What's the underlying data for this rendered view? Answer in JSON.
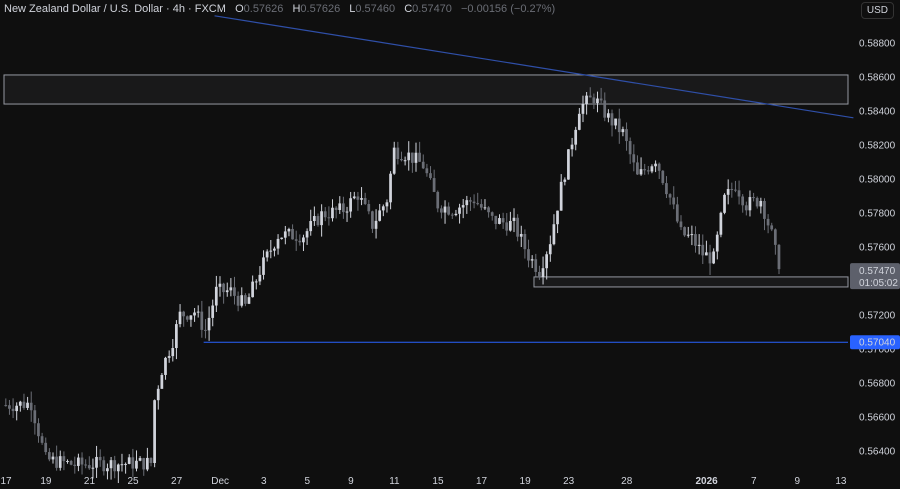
{
  "legend": {
    "title": "New Zealand Dollar / U.S. Dollar · 4h · FXCM",
    "o_label": "O",
    "o": "0.57626",
    "h_label": "H",
    "h": "0.57626",
    "l_label": "L",
    "l": "0.57460",
    "c_label": "C",
    "c": "0.57470",
    "change": "−0.00156 (−0.27%)"
  },
  "currency": "USD",
  "colors": {
    "bg": "#0f0f0f",
    "candle": "#d1d4dc",
    "candle_down": "#6b6e76",
    "trendline": "#2f4fa8",
    "level": "#2962ff",
    "zone": "#9598a1"
  },
  "chart_data": {
    "type": "candlestick",
    "title": "New Zealand Dollar / U.S. Dollar · 4h · FXCM",
    "ylim": [
      0.5632,
      0.5896
    ],
    "y_ticks": [
      "0.58800",
      "0.58600",
      "0.58400",
      "0.58200",
      "0.58000",
      "0.57800",
      "0.57600",
      "0.57400",
      "0.57200",
      "0.57000",
      "0.56800",
      "0.56600",
      "0.56400"
    ],
    "x_ticks": [
      {
        "label": "17",
        "bar": 0
      },
      {
        "label": "19",
        "bar": 11
      },
      {
        "label": "21",
        "bar": 23
      },
      {
        "label": "25",
        "bar": 35
      },
      {
        "label": "27",
        "bar": 47
      },
      {
        "label": "Dec",
        "bar": 59
      },
      {
        "label": "3",
        "bar": 71
      },
      {
        "label": "5",
        "bar": 83
      },
      {
        "label": "9",
        "bar": 95
      },
      {
        "label": "11",
        "bar": 107
      },
      {
        "label": "15",
        "bar": 119
      },
      {
        "label": "17",
        "bar": 131
      },
      {
        "label": "19",
        "bar": 143
      },
      {
        "label": "23",
        "bar": 155
      },
      {
        "label": "28",
        "bar": 171
      },
      {
        "label": "2026",
        "bar": 193,
        "bold": true
      },
      {
        "label": "7",
        "bar": 206
      },
      {
        "label": "9",
        "bar": 218
      },
      {
        "label": "13",
        "bar": 230
      }
    ],
    "bars_total": 234,
    "price_path": [
      [
        0,
        0.5667
      ],
      [
        7,
        0.5668
      ],
      [
        11,
        0.5635
      ],
      [
        19,
        0.5632
      ],
      [
        40,
        0.5633
      ],
      [
        41,
        0.567
      ],
      [
        43,
        0.5688
      ],
      [
        46,
        0.5705
      ],
      [
        48,
        0.572
      ],
      [
        52,
        0.5722
      ],
      [
        55,
        0.5711
      ],
      [
        58,
        0.5734
      ],
      [
        62,
        0.5734
      ],
      [
        66,
        0.5725
      ],
      [
        70,
        0.5746
      ],
      [
        75,
        0.5767
      ],
      [
        82,
        0.5767
      ],
      [
        87,
        0.5779
      ],
      [
        93,
        0.5782
      ],
      [
        97,
        0.5791
      ],
      [
        101,
        0.5773
      ],
      [
        105,
        0.5788
      ],
      [
        107,
        0.5817
      ],
      [
        111,
        0.5814
      ],
      [
        115,
        0.5808
      ],
      [
        119,
        0.5785
      ],
      [
        123,
        0.5782
      ],
      [
        129,
        0.5788
      ],
      [
        134,
        0.5776
      ],
      [
        140,
        0.5773
      ],
      [
        144,
        0.5755
      ],
      [
        147,
        0.5746
      ],
      [
        150,
        0.5764
      ],
      [
        153,
        0.5795
      ],
      [
        155,
        0.5813
      ],
      [
        158,
        0.5842
      ],
      [
        162,
        0.5848
      ],
      [
        166,
        0.5836
      ],
      [
        170,
        0.5827
      ],
      [
        174,
        0.5801
      ],
      [
        179,
        0.5812
      ],
      [
        183,
        0.5789
      ],
      [
        186,
        0.5768
      ],
      [
        189,
        0.5765
      ],
      [
        192,
        0.5756
      ],
      [
        195,
        0.5753
      ],
      [
        198,
        0.5788
      ],
      [
        201,
        0.5797
      ],
      [
        204,
        0.5785
      ],
      [
        208,
        0.5788
      ],
      [
        211,
        0.5767
      ],
      [
        213,
        0.5747
      ]
    ],
    "horizontal_levels": [
      {
        "price": 0.5704,
        "label": "0.57040",
        "from_bar": 55
      }
    ],
    "zones": [
      {
        "from": 0.58441,
        "to": 0.58612,
        "from_bar": 0
      },
      {
        "from": 0.57365,
        "to": 0.57424,
        "from_bar": 146
      }
    ],
    "trendline": {
      "from": [
        58,
        0.5896
      ],
      "to": [
        234,
        0.5836
      ]
    },
    "last_price": {
      "price": 0.5747,
      "label": "0.57470",
      "countdown": "01:05:02"
    }
  }
}
